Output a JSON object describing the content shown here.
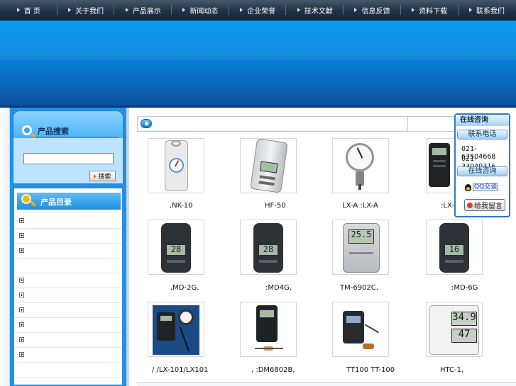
{
  "nav": {
    "items": [
      {
        "label": "首  页"
      },
      {
        "label": "关于我们"
      },
      {
        "label": "产品展示"
      },
      {
        "label": "新闻动态"
      },
      {
        "label": "企业荣誉"
      },
      {
        "label": "技术文献"
      },
      {
        "label": "信息反馈"
      },
      {
        "label": "资料下载"
      },
      {
        "label": "联系我们"
      }
    ]
  },
  "sidebar": {
    "search_title": "产品搜索",
    "search_value": "",
    "search_button": "搜索",
    "catalog_title": "产品目录",
    "catalog_rows": [
      {
        "has_plus": true
      },
      {
        "has_plus": true
      },
      {
        "has_plus": true
      },
      {
        "has_plus": false
      },
      {
        "has_plus": true
      },
      {
        "has_plus": true
      },
      {
        "has_plus": true
      },
      {
        "has_plus": true
      },
      {
        "has_plus": true
      },
      {
        "has_plus": true
      },
      {
        "has_plus": false
      }
    ]
  },
  "products": [
    {
      "name": ",NK-10",
      "icon": "force-gauge-icon"
    },
    {
      "name": "HF-50",
      "icon": "digital-force-gauge-icon"
    },
    {
      "name": "LX-A    :LX-A",
      "icon": "durometer-icon"
    },
    {
      "name": ":LX-1",
      "icon": "lux-meter-icon"
    },
    {
      "name": ",MD-2G,",
      "icon": "moisture-meter-icon",
      "reading": "28"
    },
    {
      "name": ":MD4G,",
      "icon": "moisture-meter-icon",
      "reading": "28"
    },
    {
      "name": "TM-6902C,",
      "icon": "thermometer-icon",
      "reading": "25.5"
    },
    {
      "name": ":MD-6G",
      "icon": "moisture-meter-icon",
      "reading": "16"
    },
    {
      "name": "/    /LX-101/LX101",
      "icon": "light-meter-icon"
    },
    {
      "name": ",    :DM6802B,",
      "icon": "probe-thermometer-icon"
    },
    {
      "name": "TT100 TT-100",
      "icon": "thickness-gauge-icon"
    },
    {
      "name": "HTC-1,",
      "icon": "hygrometer-icon",
      "reading": "34.9",
      "reading2": "47"
    }
  ],
  "consult": {
    "title": "在线咨询",
    "phone_tab": "联系电话",
    "phone1": "021-63504668",
    "phone2": "021-33040316",
    "online_tab": "在线咨询",
    "qq_label": "QQ交谈",
    "message_button": "给我留言"
  },
  "colors": {
    "banner_blue": "#0a9bf2",
    "nav_dark": "#223246",
    "sidebar_blue": "#2390e5"
  }
}
